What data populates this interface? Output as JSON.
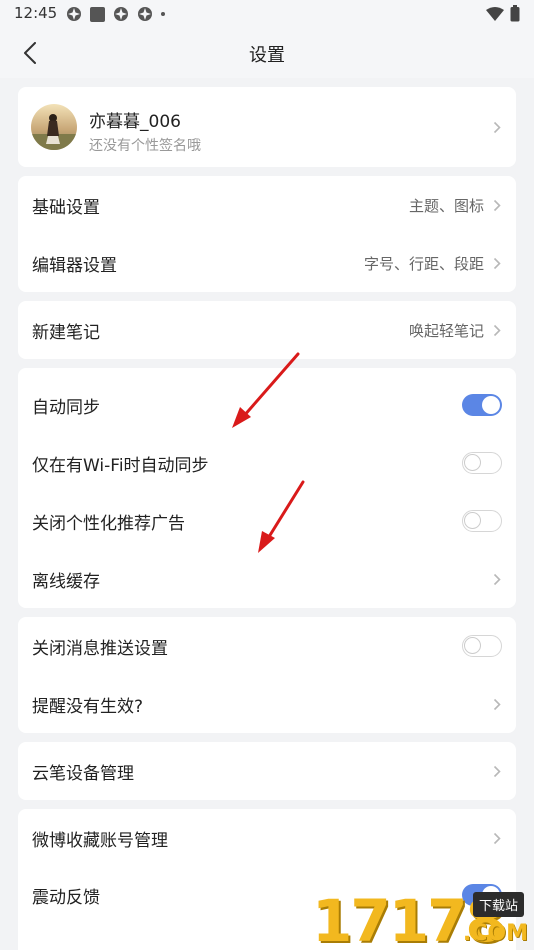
{
  "status_bar": {
    "time": "12:45"
  },
  "header": {
    "title": "设置"
  },
  "profile": {
    "name": "亦暮暮_006",
    "signature": "还没有个性签名哦"
  },
  "group1": [
    {
      "label": "基础设置",
      "value": "主题、图标"
    },
    {
      "label": "编辑器设置",
      "value": "字号、行距、段距"
    }
  ],
  "group2": [
    {
      "label": "新建笔记",
      "value": "唤起轻笔记"
    }
  ],
  "group3": [
    {
      "label": "自动同步",
      "toggle": "on"
    },
    {
      "label": "仅在有Wi-Fi时自动同步",
      "toggle": "off"
    },
    {
      "label": "关闭个性化推荐广告",
      "toggle": "off"
    },
    {
      "label": "离线缓存"
    }
  ],
  "group4": [
    {
      "label": "关闭消息推送设置",
      "toggle": "off"
    },
    {
      "label": "提醒没有生效?"
    }
  ],
  "group5": [
    {
      "label": "云笔设备管理"
    }
  ],
  "group6": [
    {
      "label": "微博收藏账号管理"
    },
    {
      "label": "震动反馈",
      "toggle": "on"
    }
  ],
  "watermark": {
    "number": "17178",
    "tag": "下载站",
    "suffix": ".COM"
  },
  "colors": {
    "accent": "#5b86e5",
    "annotation_arrow": "#d91a1a",
    "watermark": "#f2b81f"
  }
}
